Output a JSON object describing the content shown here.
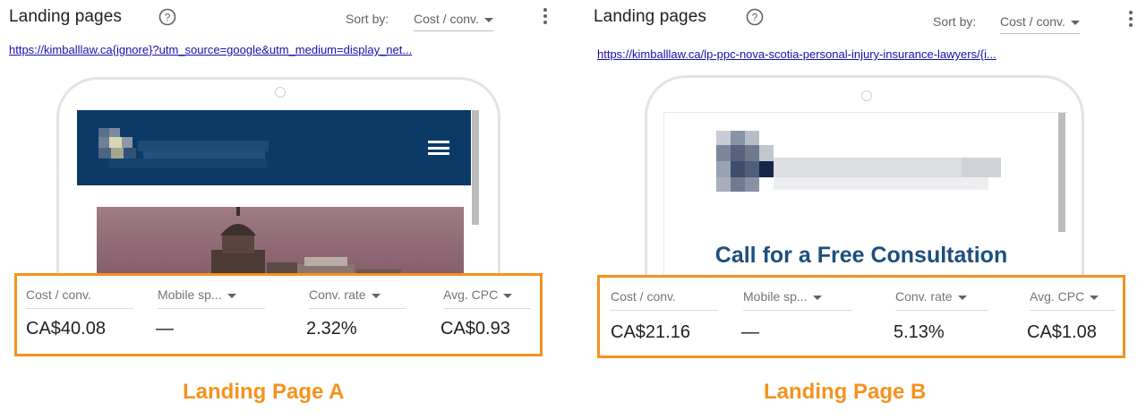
{
  "colors": {
    "accent_orange": "#f5921e",
    "link_blue": "#1a0dab",
    "header_navy": "#0c3a66",
    "cta_blue": "#1d4f7c"
  },
  "panel_a": {
    "title": "Landing pages",
    "sort_label": "Sort by:",
    "sort_value": "Cost / conv.",
    "url": "https://kimballlaw.ca{ignore}?utm_source=google&utm_medium=display_net...",
    "metrics": {
      "headers": [
        "Cost / conv.",
        "Mobile sp...",
        "Conv. rate",
        "Avg. CPC"
      ],
      "values": [
        "CA$40.08",
        "—",
        "2.32%",
        "CA$0.93"
      ]
    },
    "caption": "Landing Page A"
  },
  "panel_b": {
    "title": "Landing pages",
    "sort_label": "Sort by:",
    "sort_value": "Cost / conv.",
    "url": "https://kimballlaw.ca/lp-ppc-nova-scotia-personal-injury-insurance-lawyers/{i...",
    "cta_heading": "Call for a Free Consultation",
    "metrics": {
      "headers": [
        "Cost / conv.",
        "Mobile sp...",
        "Conv. rate",
        "Avg. CPC"
      ],
      "values": [
        "CA$21.16",
        "—",
        "5.13%",
        "CA$1.08"
      ]
    },
    "caption": "Landing Page B"
  }
}
